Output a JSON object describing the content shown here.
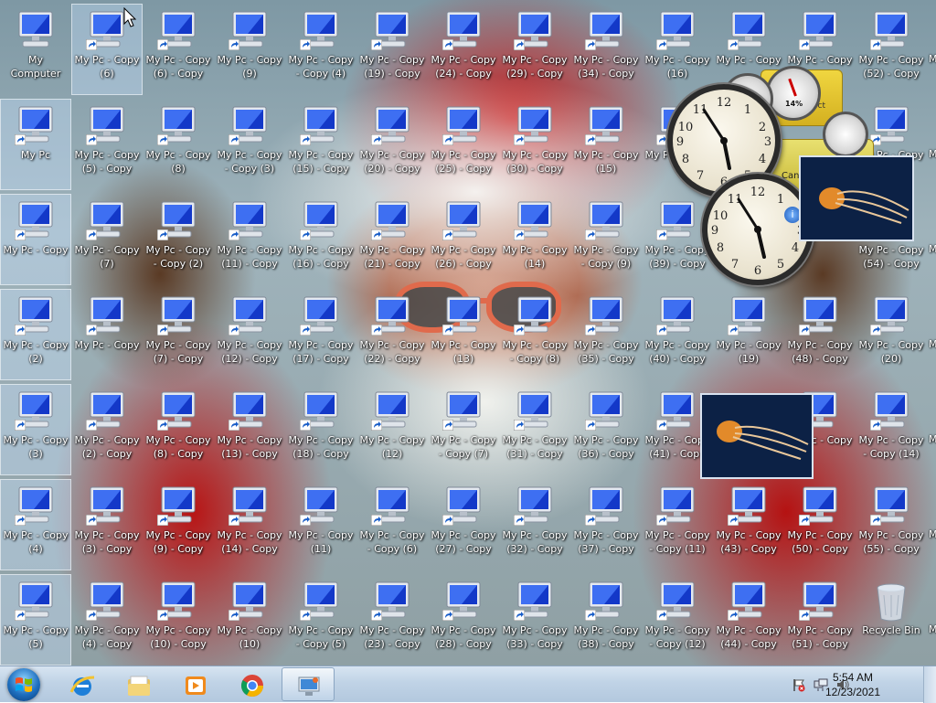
{
  "desktop": {
    "columns": [
      [
        "My Computer",
        "My Pc",
        "My Pc - Copy",
        "My Pc - Copy (2)",
        "My Pc - Copy (3)",
        "My Pc - Copy (4)",
        "My Pc - Copy (5)"
      ],
      [
        "My Pc - Copy (6)",
        "My Pc - Copy (5) - Copy",
        "My Pc - Copy (7)",
        "My Pc - Copy",
        "My Pc - Copy (2) - Copy",
        "My Pc - Copy (3) - Copy",
        "My Pc - Copy (4) - Copy"
      ],
      [
        "My Pc - Copy (6) - Copy",
        "My Pc - Copy (8)",
        "My Pc - Copy - Copy (2)",
        "My Pc - Copy (7) - Copy",
        "My Pc - Copy (8) - Copy",
        "My Pc - Copy (9) - Copy",
        "My Pc - Copy (10) - Copy"
      ],
      [
        "My Pc - Copy (9)",
        "My Pc - Copy - Copy (3)",
        "My Pc - Copy (11) - Copy",
        "My Pc - Copy (12) - Copy",
        "My Pc - Copy (13) - Copy",
        "My Pc - Copy (14) - Copy",
        "My Pc - Copy (10)"
      ],
      [
        "My Pc - Copy - Copy (4)",
        "My Pc - Copy (15) - Copy",
        "My Pc - Copy (16) - Copy",
        "My Pc - Copy (17) - Copy",
        "My Pc - Copy (18) - Copy",
        "My Pc - Copy (11)",
        "My Pc - Copy - Copy (5)"
      ],
      [
        "My Pc - Copy (19) - Copy",
        "My Pc - Copy (20) - Copy",
        "My Pc - Copy (21) - Copy",
        "My Pc - Copy (22) - Copy",
        "My Pc - Copy (12)",
        "My Pc - Copy - Copy (6)",
        "My Pc - Copy (23) - Copy"
      ],
      [
        "My Pc - Copy (24) - Copy",
        "My Pc - Copy (25) - Copy",
        "My Pc - Copy (26) - Copy",
        "My Pc - Copy (13)",
        "My Pc - Copy - Copy (7)",
        "My Pc - Copy (27) - Copy",
        "My Pc - Copy (28) - Copy"
      ],
      [
        "My Pc - Copy (29) - Copy",
        "My Pc - Copy (30) - Copy",
        "My Pc - Copy (14)",
        "My Pc - Copy - Copy (8)",
        "My Pc - Copy (31) - Copy",
        "My Pc - Copy (32) - Copy",
        "My Pc - Copy (33) - Copy"
      ],
      [
        "My Pc - Copy (34) - Copy",
        "My Pc - Copy (15)",
        "My Pc - Copy - Copy (9)",
        "My Pc - Copy (35) - Copy",
        "My Pc - Copy (36) - Copy",
        "My Pc - Copy (37) - Copy",
        "My Pc - Copy (38) - Copy"
      ],
      [
        "My Pc - Copy (16)",
        "My Pc - Copy",
        "My Pc - Copy (39) - Copy",
        "My Pc - Copy (40) - Copy",
        "My Pc - Copy (41) - Copy",
        "My Pc - Copy - Copy (11)",
        "My Pc - Copy - Copy (12)"
      ],
      [
        "My Pc - Copy",
        "",
        "",
        "My Pc - Copy (19)",
        "",
        "My Pc - Copy (43) - Copy",
        "My Pc - Copy (44) - Copy"
      ],
      [
        "My Pc - Copy",
        "",
        "",
        "My Pc - Copy (48) - Copy",
        "My Pc - Copy",
        "My Pc - Copy (50) - Copy",
        "My Pc - Copy (51) - Copy"
      ],
      [
        "My Pc - Copy (52) - Copy",
        "My Pc - Copy",
        "My Pc - Copy (54) - Copy",
        "My Pc - Copy (20)",
        "My Pc - Copy - Copy (14)",
        "My Pc - Copy (55) - Copy",
        "Recycle Bin"
      ]
    ],
    "partial_edge_labels": [
      "M",
      "M",
      "M",
      "M",
      "M",
      "M",
      "M"
    ]
  },
  "gadgets": {
    "cpu_meter_percent": "14%",
    "currency_label": "Cana",
    "card_label": "ct"
  },
  "taskbar": {
    "start": "Start",
    "pinned": [
      "internet-explorer-icon",
      "file-explorer-icon",
      "media-player-icon",
      "chrome-icon",
      "remote-desktop-icon"
    ],
    "active_index": 4,
    "clock": {
      "time": "5:54 AM",
      "date": "12/23/2021"
    }
  }
}
